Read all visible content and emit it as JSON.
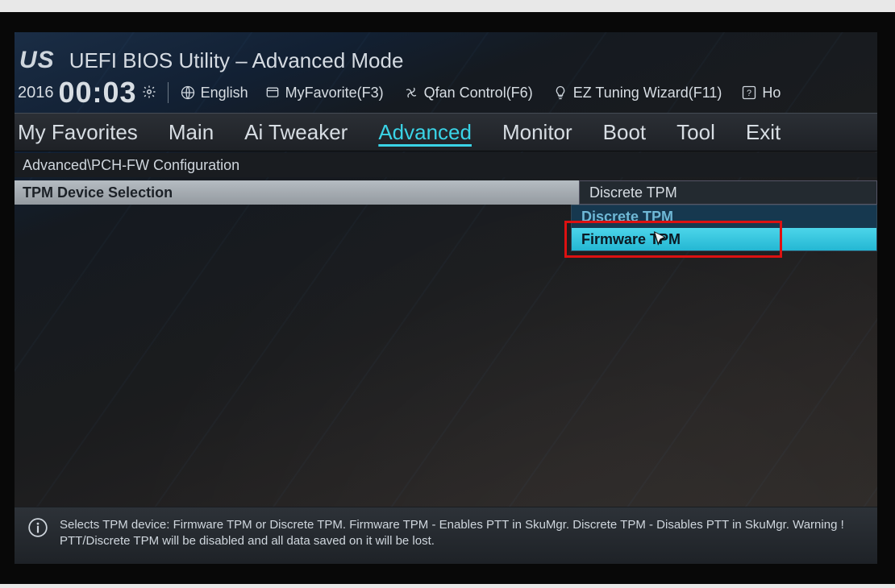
{
  "brand": "US",
  "app_title": "UEFI BIOS Utility – Advanced Mode",
  "year": "2016",
  "clock": "00:03",
  "toolbar": {
    "language": "English",
    "favorites": "MyFavorite(F3)",
    "qfan": "Qfan Control(F6)",
    "wizard": "EZ Tuning Wizard(F11)",
    "help": "Ho"
  },
  "tabs": [
    "My Favorites",
    "Main",
    "Ai Tweaker",
    "Advanced",
    "Monitor",
    "Boot",
    "Tool",
    "Exit"
  ],
  "active_tab_index": 3,
  "breadcrumb": "Advanced\\PCH-FW Configuration",
  "setting": {
    "label": "TPM Device Selection",
    "value": "Discrete TPM",
    "options": [
      "Discrete TPM",
      "Firmware TPM"
    ],
    "hover_index": 1
  },
  "help_text": "Selects TPM device: Firmware TPM or Discrete TPM. Firmware TPM - Enables PTT in SkuMgr. Discrete TPM - Disables PTT in SkuMgr. Warning !  PTT/Discrete TPM will be disabled and all data saved on it will be lost."
}
